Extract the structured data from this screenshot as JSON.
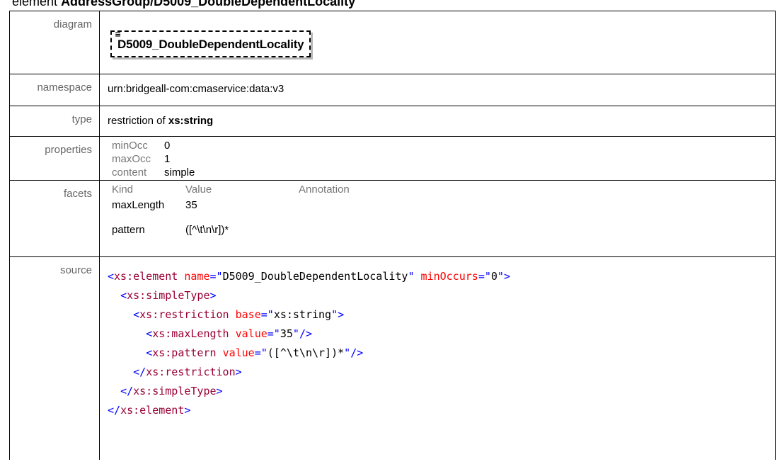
{
  "page_title": {
    "prefix": "element",
    "name": "AddressGroup/D5009_DoubleDependentLocality"
  },
  "rows": {
    "diagram": {
      "label": "diagram",
      "element_name": "D5009_DoubleDependentLocality"
    },
    "namespace": {
      "label": "namespace",
      "value": "urn:bridgeall-com:cmaservice:data:v3"
    },
    "type": {
      "label": "type",
      "prefix": "restriction of",
      "base": "xs:string"
    },
    "properties": {
      "label": "properties",
      "items": [
        {
          "key": "minOcc",
          "value": "0"
        },
        {
          "key": "maxOcc",
          "value": "1"
        },
        {
          "key": "content",
          "value": "simple"
        }
      ]
    },
    "facets": {
      "label": "facets",
      "headers": [
        "Kind",
        "Value",
        "Annotation"
      ],
      "items": [
        {
          "kind": "maxLength",
          "value": "35",
          "annotation": ""
        },
        {
          "kind": "pattern",
          "value": "([^\\t\\n\\r])*",
          "annotation": ""
        }
      ]
    },
    "source": {
      "label": "source",
      "lines": [
        {
          "indent": "",
          "open": "<",
          "tag": "xs:element",
          "attrs": [
            {
              "name": "name",
              "value": "D5009_DoubleDependentLocality"
            },
            {
              "name": "minOccurs",
              "value": "0"
            }
          ],
          "close": ">"
        },
        {
          "indent": "  ",
          "open": "<",
          "tag": "xs:simpleType",
          "attrs": [],
          "close": ">"
        },
        {
          "indent": "    ",
          "open": "<",
          "tag": "xs:restriction",
          "attrs": [
            {
              "name": "base",
              "value": "xs:string"
            }
          ],
          "close": ">"
        },
        {
          "indent": "      ",
          "open": "<",
          "tag": "xs:maxLength",
          "attrs": [
            {
              "name": "value",
              "value": "35"
            }
          ],
          "close": "/>"
        },
        {
          "indent": "      ",
          "open": "<",
          "tag": "xs:pattern",
          "attrs": [
            {
              "name": "value",
              "value": "([^\\t\\n\\r])*"
            }
          ],
          "close": "/>"
        },
        {
          "indent": "    ",
          "open": "</",
          "tag": "xs:restriction",
          "attrs": [],
          "close": ">"
        },
        {
          "indent": "  ",
          "open": "</",
          "tag": "xs:simpleType",
          "attrs": [],
          "close": ">"
        },
        {
          "indent": "",
          "open": "</",
          "tag": "xs:element",
          "attrs": [],
          "close": ">"
        }
      ]
    }
  },
  "colors": {
    "tag": "#990033",
    "punct": "#0000ff",
    "attr_name": "#ff0000",
    "attr_value": "#000000",
    "label_text": "#666666"
  }
}
